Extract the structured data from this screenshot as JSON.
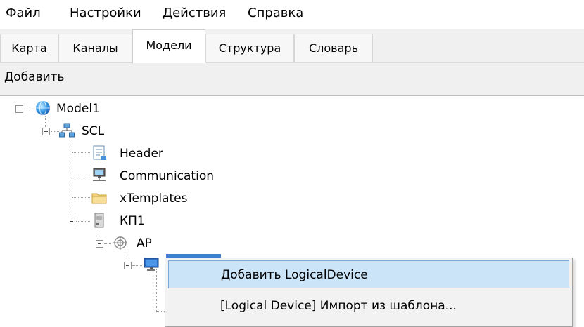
{
  "menubar": {
    "items": [
      "Файл",
      "Настройки",
      "Действия",
      "Справка"
    ]
  },
  "tabs": [
    "Карта",
    "Каналы",
    "Модели",
    "Структура",
    "Словарь"
  ],
  "active_tab": "Модели",
  "toolbar": {
    "add_label": "Добавить"
  },
  "tree": {
    "model": "Model1",
    "scl": "SCL",
    "header": "Header",
    "communication": "Communication",
    "xtemplates": "xTemplates",
    "kp1": "КП1",
    "ap": "AP"
  },
  "context_menu": {
    "items": [
      "Добавить LogicalDevice",
      "[Logical Device] Импорт из шаблона..."
    ]
  },
  "icons": {
    "model": "globe-icon",
    "scl": "network-icon",
    "header": "document-icon",
    "communication": "computer-network-icon",
    "xtemplates": "folder-icon",
    "kp1": "server-icon",
    "ap": "access-point-icon",
    "device": "monitor-icon"
  },
  "colors": {
    "selection": "#3c7fd1",
    "menu_highlight": "#cce4f7",
    "menu_highlight_border": "#7aa7d6"
  }
}
